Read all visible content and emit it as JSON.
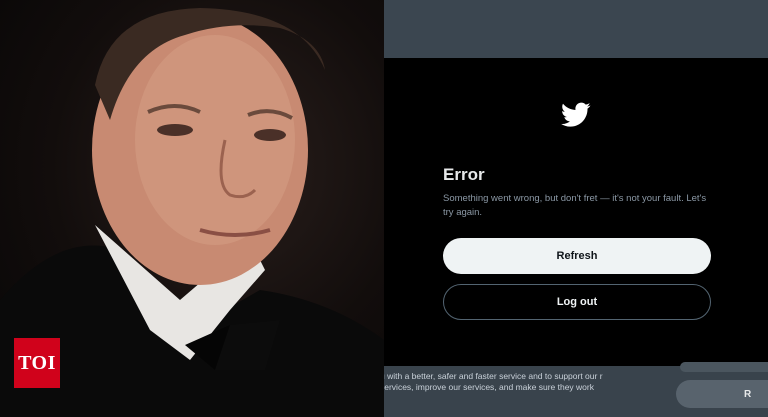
{
  "badge": {
    "label": "TOI"
  },
  "error_dialog": {
    "icon": "twitter-bird-icon",
    "title": "Error",
    "message": "Something went wrong, but don't fret — it's not your fault. Let's try again.",
    "refresh_label": "Refresh",
    "logout_label": "Log out"
  },
  "cookie_banner": {
    "text": "u with a better, safer and faster service and to support our r services, improve our services, and make sure they work",
    "button_label": "R"
  },
  "colors": {
    "badge_red": "#d0021b",
    "dialog_bg": "#000000",
    "refresh_bg": "#eff3f4",
    "banner_bg": "#39434c"
  }
}
